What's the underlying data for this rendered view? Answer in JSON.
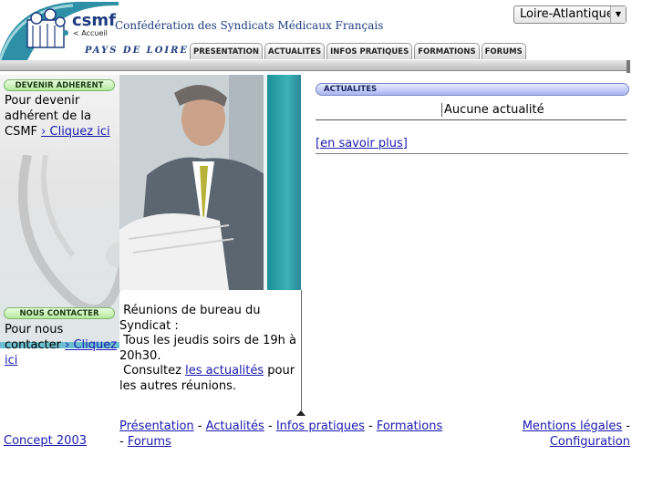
{
  "header": {
    "logo_text": "csmf",
    "accueil_label": "< Accueil",
    "org_title": "Confédération des Syndicats Médicaux Français",
    "region_label": "PAYS DE LOIRE",
    "region_select_value": "Loire-Atlantique",
    "tabs": [
      "PRESENTATION",
      "ACTUALITES",
      "INFOS PRATIQUES",
      "FORMATIONS",
      "FORUMS"
    ]
  },
  "sidebar": {
    "adherent_title": "DEVENIR ADHERENT",
    "adherent_text": "Pour devenir adhérent de la CSMF",
    "adherent_link": "› Cliquez ici",
    "contact_title": "NOUS CONTACTER",
    "contact_text": "Pour nous contacter",
    "contact_link": "› Cliquez ici"
  },
  "bureau": {
    "line1": "Réunions de bureau du Syndicat :",
    "line2": "Tous les jeudis soirs de 19h à 20h30.",
    "line3_pre": "Consultez",
    "line3_link": "les actualités",
    "line3_post": "pour les autres réunions."
  },
  "news": {
    "title": "ACTUALITES",
    "empty_text": "Aucune actualité",
    "more_link": "[en savoir plus]"
  },
  "footer": {
    "concept": "Concept 2003",
    "nav": [
      "Présentation",
      "Actualités",
      "Infos pratiques",
      "Formations",
      "Forums"
    ],
    "legal": "Mentions légales",
    "config": "Configuration"
  },
  "colors": {
    "brand_blue": "#1f3d80",
    "link": "#1a1ab0",
    "teal": "#3ab2b6",
    "green_pill": "#b6e79d",
    "blue_pill": "#aab4ef"
  }
}
